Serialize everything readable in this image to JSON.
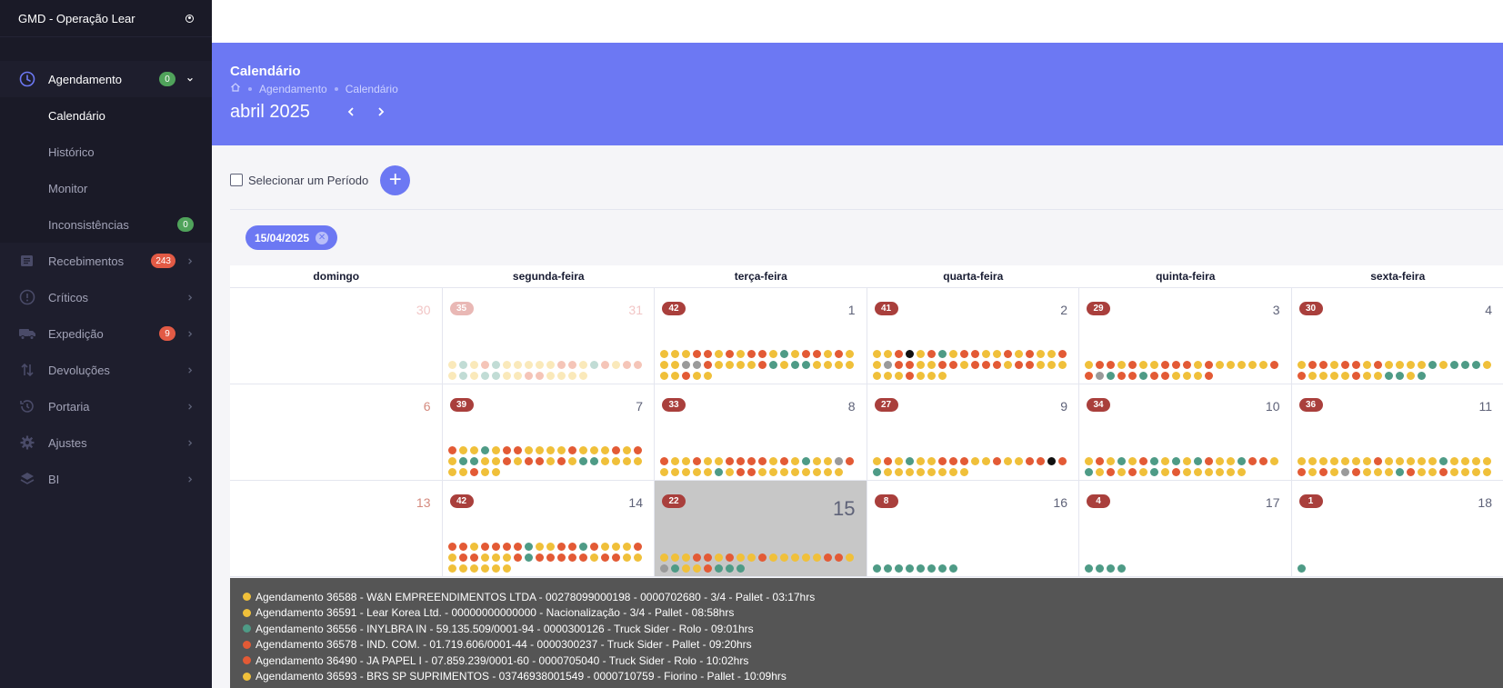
{
  "brand": {
    "title": "GMD - Operação Lear"
  },
  "sidebar": {
    "agendamento": {
      "label": "Agendamento",
      "badge": "0"
    },
    "sub": [
      {
        "label": "Calendário"
      },
      {
        "label": "Histórico"
      },
      {
        "label": "Monitor"
      },
      {
        "label": "Inconsistências",
        "badge": "0"
      }
    ],
    "items": [
      {
        "label": "Recebimentos",
        "badge": "243",
        "icon": "list-icon"
      },
      {
        "label": "Críticos",
        "icon": "alert-icon"
      },
      {
        "label": "Expedição",
        "badge": "9",
        "icon": "truck-icon"
      },
      {
        "label": "Devoluções",
        "icon": "swap-icon"
      },
      {
        "label": "Portaria",
        "icon": "history-icon"
      },
      {
        "label": "Ajustes",
        "icon": "gear-icon"
      },
      {
        "label": "BI",
        "icon": "layers-icon"
      }
    ]
  },
  "header": {
    "title": "Calendário",
    "breadcrumb": [
      "Agendamento",
      "Calendário"
    ],
    "month": "abril 2025"
  },
  "toolbar": {
    "period_label": "Selecionar um Período",
    "add_label": "+"
  },
  "chip": {
    "date": "15/04/2025"
  },
  "colors": {
    "Y": "#f0c03a",
    "O": "#e35a35",
    "T": "#4e9b86",
    "G": "#9a9a9a",
    "B": "#111111"
  },
  "calendar": {
    "weekdays": [
      "domingo",
      "segunda-feira",
      "terça-feira",
      "quarta-feira",
      "quinta-feira",
      "sexta-feira"
    ],
    "weeks": [
      [
        {
          "day": "30",
          "other": true
        },
        {
          "day": "31",
          "other": true,
          "count": "35",
          "dots": "YTYOTYYYYYOOYTOYOOYTYTTYYOOYYYY"
        },
        {
          "day": "1",
          "count": "42",
          "dots": "YYYOOYOYOOYTYOOYOYYYGGOYYYYOTYTTYYYYYYOYY"
        },
        {
          "day": "2",
          "count": "41",
          "dots": "YYOBYOTYOOYYOYOYYOYGOOYYOOYOOOYOOYYYYYYOYYY"
        },
        {
          "day": "3",
          "count": "29",
          "dots": "YOOYOYYOOOYOYYYYYOOGTOOTOOYYYO"
        },
        {
          "day": "4",
          "count": "30",
          "dots": "YOOYOOYOYYYYTYTTTYOYYYYOYYTTYT"
        }
      ],
      [
        {
          "day": "6",
          "sunday": true
        },
        {
          "day": "7",
          "count": "39",
          "dots": "OYYTYOOYYYYOYYYOYOYTTYYOYOOYOYTTYYYYYYOYY"
        },
        {
          "day": "8",
          "count": "33",
          "dots": "OYYOYYOOOOYOYTYYGOYYYYYTYOOYYYYYYYY"
        },
        {
          "day": "9",
          "count": "27",
          "dots": "YOYTYYOOOYYOYYOOBOTYYYYYYYY"
        },
        {
          "day": "10",
          "count": "34",
          "dots": "YOYTYOTYTYTOYYTOOYTYOYOYTYOYYYYYY"
        },
        {
          "day": "11",
          "count": "36",
          "dots": "YYYYYYYOYYYYYTYYYYOYOYGOYYYTOYYOYYYY"
        }
      ],
      [
        {
          "day": "13",
          "sunday": true
        },
        {
          "day": "14",
          "count": "42",
          "dots": "OOYOOOOTYYOOTOYYYOYOOYYYOTOOOOOYOOYYYYYYYY"
        },
        {
          "day": "15",
          "today": true,
          "count": "22",
          "dots": "YYYOOYOYYOYYYYYOOYGTYYOTTT"
        },
        {
          "day": "16",
          "count": "8",
          "dots": "TTTTTTTT"
        },
        {
          "day": "17",
          "count": "4",
          "dots": "TTTT"
        },
        {
          "day": "18",
          "count": "1",
          "dots": "T"
        }
      ]
    ]
  },
  "tooltip": [
    {
      "color": "Y",
      "text": "Agendamento 36588 - W&N EMPREENDIMENTOS LTDA - 00278099000198 - 0000702680 - 3/4 - Pallet - 03:17hrs"
    },
    {
      "color": "Y",
      "text": "Agendamento 36591 - Lear Korea Ltd. - 00000000000000 - Nacionalização - 3/4 - Pallet - 08:58hrs"
    },
    {
      "color": "T",
      "text": "Agendamento 36556 - INYLBRA IN - 59.135.509/0001-94 - 0000300126 - Truck Sider - Rolo - 09:01hrs"
    },
    {
      "color": "O",
      "text": "Agendamento 36578 - IND. COM. - 01.719.606/0001-44 - 0000300237 - Truck Sider - Pallet - 09:20hrs"
    },
    {
      "color": "O",
      "text": "Agendamento 36490 - JA PAPEL I - 07.859.239/0001-60 - 0000705040 - Truck Sider - Rolo - 10:02hrs"
    },
    {
      "color": "Y",
      "text": "Agendamento 36593 - BRS SP SUPRIMENTOS - 03746938001549 - 0000710759 - Fiorino - Pallet - 10:09hrs"
    }
  ]
}
